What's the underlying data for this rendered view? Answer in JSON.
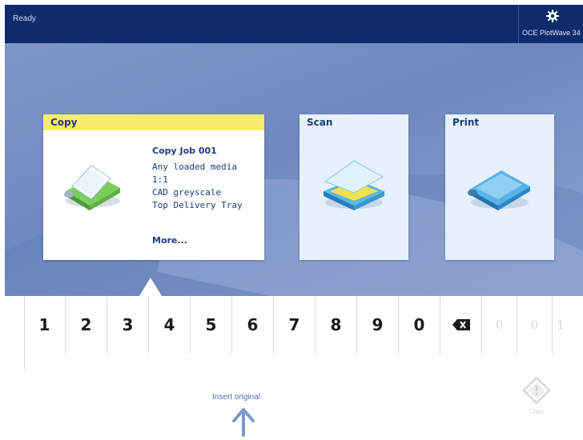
{
  "status": {
    "text": "Ready"
  },
  "device": {
    "name": "OCE PlotWave 34"
  },
  "tiles": {
    "copy": {
      "title": "Copy",
      "job_title": "Copy Job 001",
      "settings": [
        "Any loaded media",
        "1:1",
        "CAD greyscale",
        "Top Delivery Tray"
      ],
      "more_label": "More..."
    },
    "scan": {
      "title": "Scan"
    },
    "print": {
      "title": "Print"
    }
  },
  "keypad": {
    "keys": [
      "1",
      "2",
      "3",
      "4",
      "5",
      "6",
      "7",
      "8",
      "9",
      "0"
    ],
    "backspace_icon": "backspace-icon",
    "display": [
      "0",
      "0",
      "1"
    ]
  },
  "hint": {
    "text": "Insert original"
  },
  "start": {
    "label": "Copy"
  },
  "colors": {
    "topbar": "#0f2b6d",
    "copy_header": "#f7ec6b",
    "hero": "#7d95c8",
    "accent_text": "#1f3c7a"
  }
}
